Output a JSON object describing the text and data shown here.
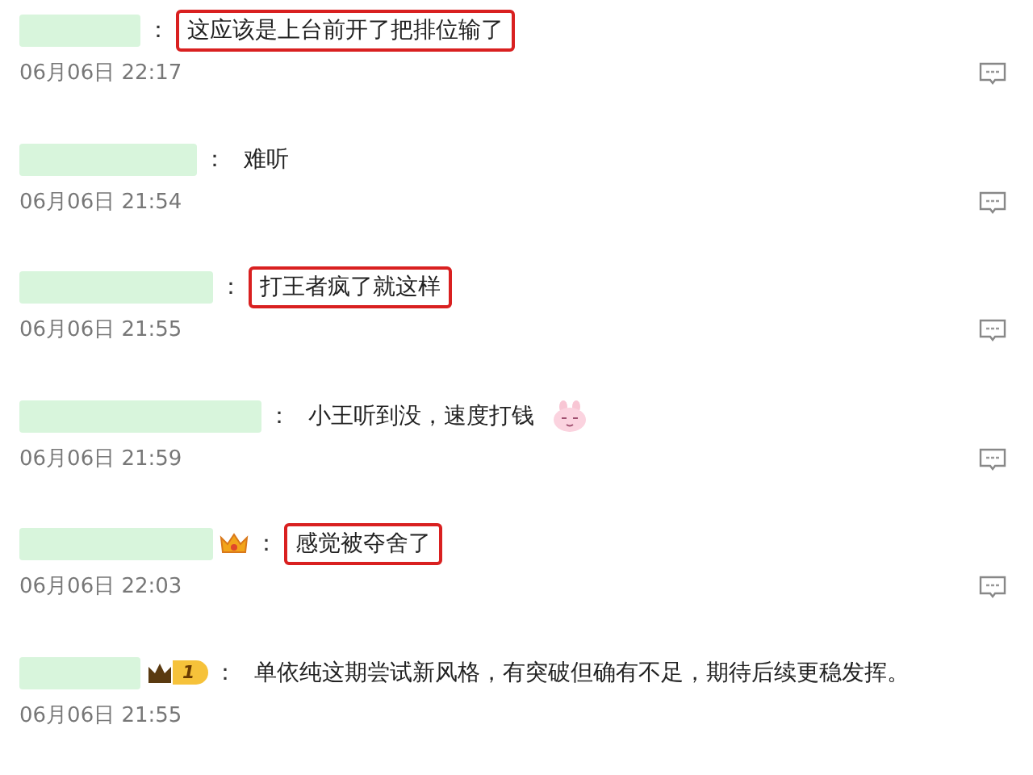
{
  "comments": [
    {
      "separator": "：",
      "text": "这应该是上台前开了把排位输了",
      "highlighted": true,
      "badge": {
        "kind": "none"
      },
      "time": "06月06日 22:17",
      "reply": true
    },
    {
      "separator": "：",
      "text": "难听",
      "highlighted": false,
      "badge": {
        "kind": "none"
      },
      "time": "06月06日 21:54",
      "reply": true
    },
    {
      "separator": "：",
      "text": "打王者疯了就这样",
      "highlighted": true,
      "badge": {
        "kind": "none"
      },
      "time": "06月06日 21:55",
      "reply": true
    },
    {
      "separator": "：",
      "text": "小王听到没，速度打钱",
      "highlighted": false,
      "emoji": true,
      "badge": {
        "kind": "none"
      },
      "time": "06月06日 21:59",
      "reply": true
    },
    {
      "separator": "：",
      "text": "感觉被夺舍了",
      "highlighted": true,
      "badge": {
        "kind": "crown"
      },
      "time": "06月06日 22:03",
      "reply": true
    },
    {
      "separator": "：",
      "text": "单依纯这期尝试新风格，有突破但确有不足，期待后续更稳发挥。",
      "highlighted": false,
      "badge": {
        "kind": "level",
        "level": "1"
      },
      "time": "06月06日 21:55",
      "reply": false
    }
  ]
}
